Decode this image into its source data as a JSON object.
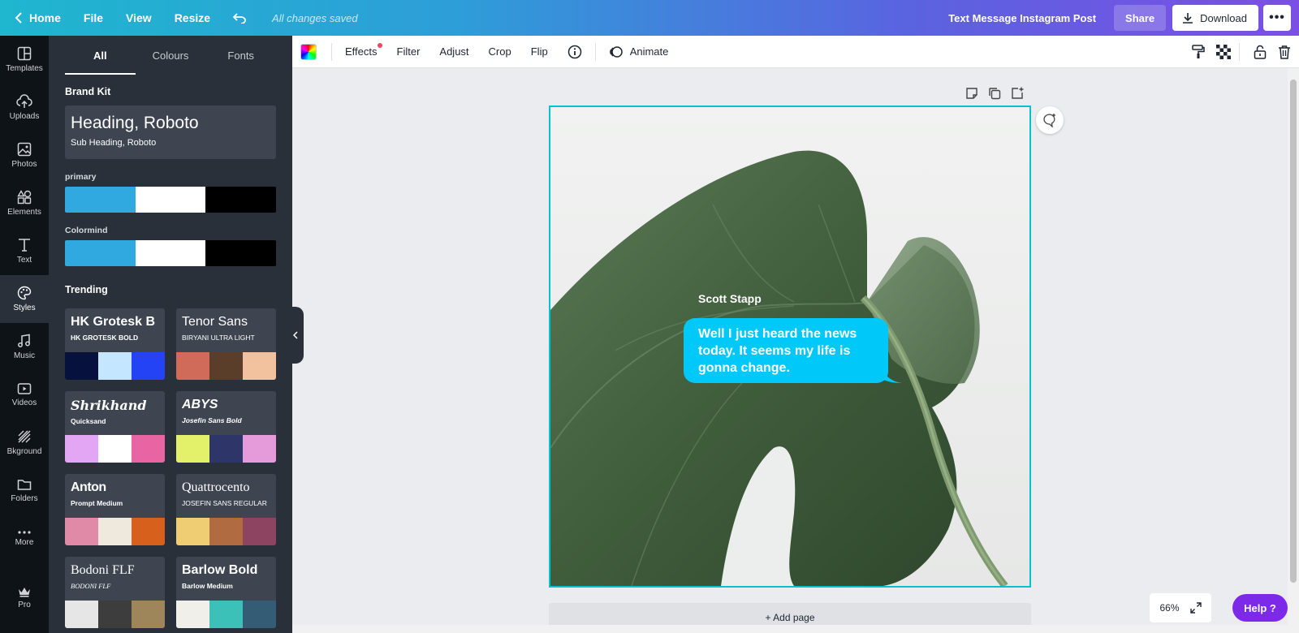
{
  "topbar": {
    "home": "Home",
    "file": "File",
    "view": "View",
    "resize": "Resize",
    "saved_status": "All changes saved",
    "doc_title": "Text Message Instagram Post",
    "share": "Share",
    "download": "Download"
  },
  "rail": {
    "items": [
      {
        "label": "Templates",
        "icon": "templates-icon"
      },
      {
        "label": "Uploads",
        "icon": "upload-icon"
      },
      {
        "label": "Photos",
        "icon": "photo-icon"
      },
      {
        "label": "Elements",
        "icon": "shapes-icon"
      },
      {
        "label": "Text",
        "icon": "text-icon"
      },
      {
        "label": "Styles",
        "icon": "palette-icon"
      },
      {
        "label": "Music",
        "icon": "music-icon"
      },
      {
        "label": "Videos",
        "icon": "video-icon"
      },
      {
        "label": "Bkground",
        "icon": "background-icon"
      },
      {
        "label": "Folders",
        "icon": "folder-icon"
      },
      {
        "label": "More",
        "icon": "more-dots-icon"
      }
    ],
    "pro": "Pro"
  },
  "panel": {
    "tabs": [
      "All",
      "Colours",
      "Fonts"
    ],
    "brand_kit": "Brand Kit",
    "brand_heading": "Heading, Roboto",
    "brand_sub": "Sub Heading, Roboto",
    "palettes": [
      {
        "label": "primary",
        "colors": [
          "#2fa9e0",
          "#ffffff",
          "#000000"
        ]
      },
      {
        "label": "Colormind",
        "colors": [
          "#2fa9e0",
          "#ffffff",
          "#000000"
        ]
      }
    ],
    "trending": "Trending",
    "cards": [
      {
        "f1": "HK Grotesk B",
        "f2": "HK GROTESK BOLD",
        "colors": [
          "#06113d",
          "#c5e6ff",
          "#2443f5"
        ]
      },
      {
        "f1": "Tenor Sans",
        "f2": "BIRYANI ULTRA LIGHT",
        "colors": [
          "#cf6b58",
          "#5b3e2a",
          "#f2c19e"
        ]
      },
      {
        "f1": "Shrikhand",
        "f2": "Quicksand",
        "colors": [
          "#e2a6f5",
          "#ffffff",
          "#e964a3"
        ]
      },
      {
        "f1": "ABYS",
        "f2": "Josefin Sans Bold",
        "colors": [
          "#e3f06a",
          "#2e3568",
          "#e59bd9"
        ]
      },
      {
        "f1": "Anton",
        "f2": "Prompt Medium",
        "colors": [
          "#e08aa8",
          "#efe9dd",
          "#d7601c"
        ]
      },
      {
        "f1": "Quattrocento",
        "f2": "JOSEFIN SANS REGULAR",
        "colors": [
          "#efcd72",
          "#b06b40",
          "#8d4460"
        ]
      },
      {
        "f1": "Bodoni FLF",
        "f2": "BODONI FLF",
        "colors": [
          "#e6e6e6",
          "#3d3d3d",
          "#9e865a"
        ]
      },
      {
        "f1": "Barlow Bold",
        "f2": "Barlow Medium",
        "colors": [
          "#f1efea",
          "#3cc1b8",
          "#355c75"
        ]
      }
    ]
  },
  "toolbar": {
    "effects": "Effects",
    "filter": "Filter",
    "adjust": "Adjust",
    "crop": "Crop",
    "flip": "Flip",
    "animate": "Animate"
  },
  "canvas": {
    "sender": "Scott Stapp",
    "message": "Well I just heard the news today. It seems my life is gonna change.",
    "add_page": "+ Add page"
  },
  "footer": {
    "zoom": "66%",
    "help": "Help  ?"
  },
  "colors": {
    "accent": "#00c4cc",
    "bubble": "#00c8f8",
    "help": "#7d2ae8",
    "panel_bg": "#293039",
    "rail_bg": "#0e1318"
  }
}
